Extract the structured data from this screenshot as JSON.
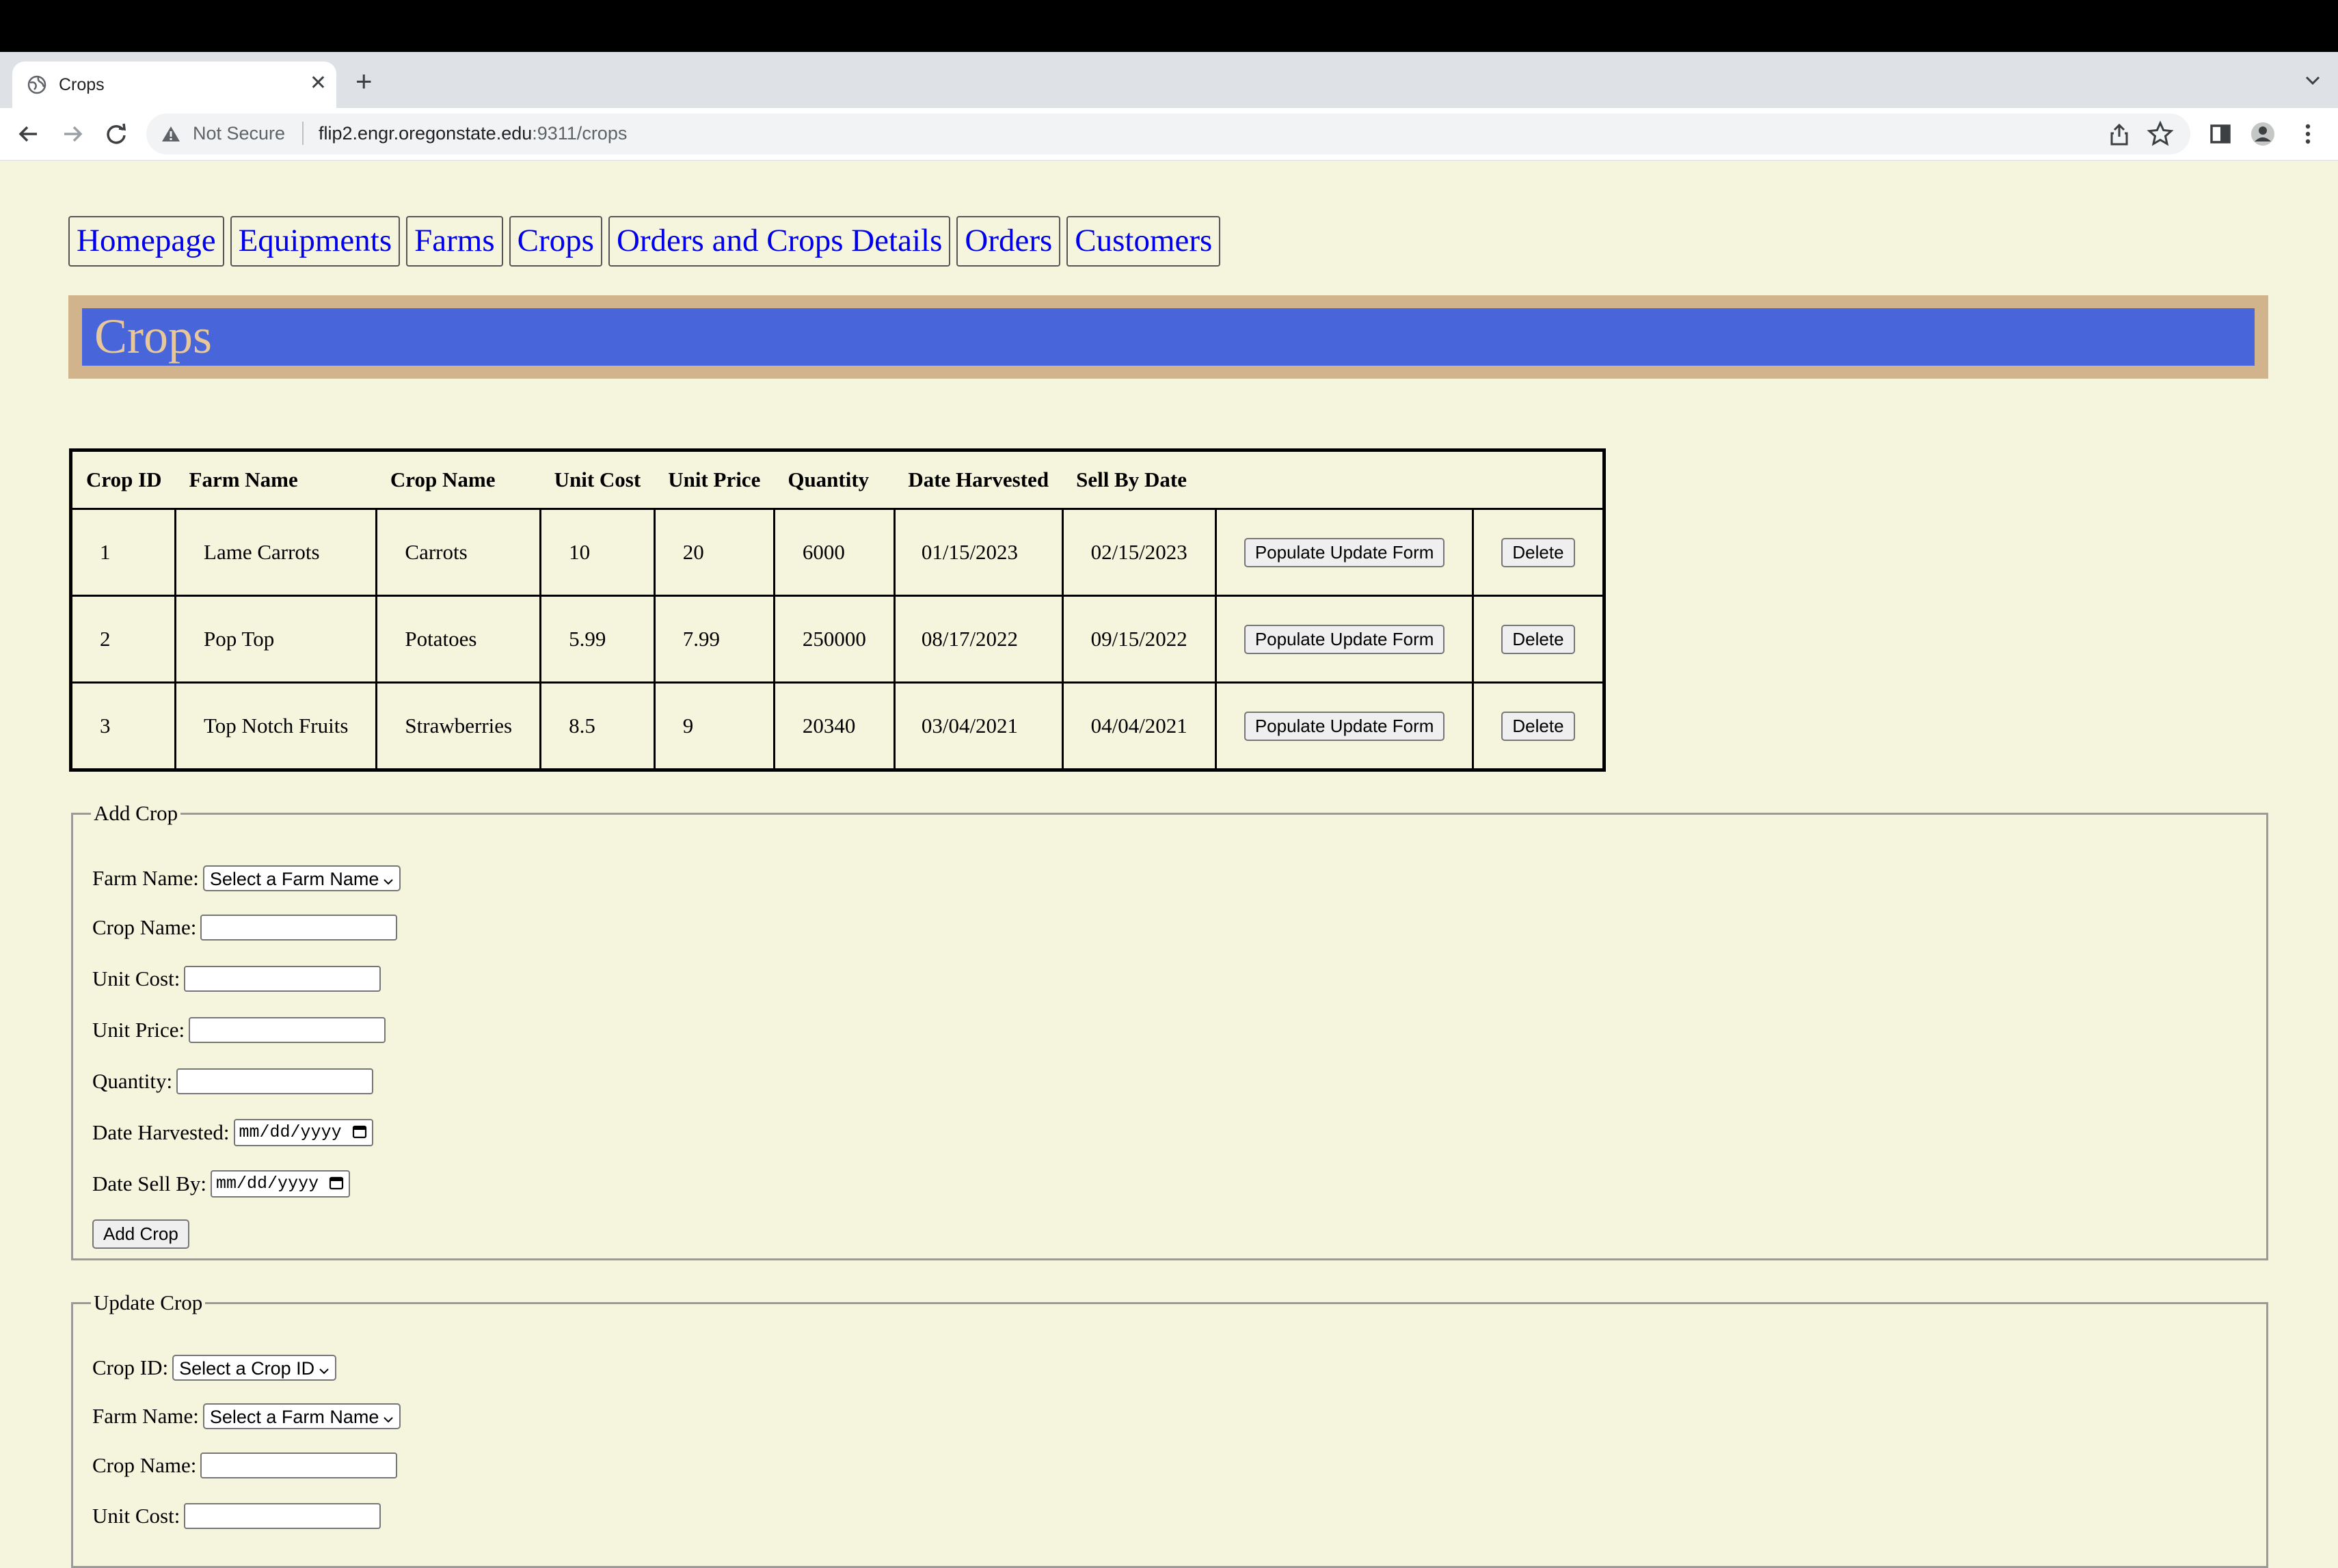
{
  "browser": {
    "tab_title": "Crops",
    "security_label": "Not Secure",
    "url_host": "flip2.engr.oregonstate.edu",
    "url_path": ":9311/crops"
  },
  "nav": [
    "Homepage",
    "Equipments",
    "Farms",
    "Crops",
    "Orders and Crops Details",
    "Orders",
    "Customers"
  ],
  "page_title": "Crops",
  "table": {
    "headers": [
      "Crop ID",
      "Farm Name",
      "Crop Name",
      "Unit Cost",
      "Unit Price",
      "Quantity",
      "Date Harvested",
      "Sell By Date"
    ],
    "rows": [
      [
        "1",
        "Lame Carrots",
        "Carrots",
        "10",
        "20",
        "6000",
        "01/15/2023",
        "02/15/2023"
      ],
      [
        "2",
        "Pop Top",
        "Potatoes",
        "5.99",
        "7.99",
        "250000",
        "08/17/2022",
        "09/15/2022"
      ],
      [
        "3",
        "Top Notch Fruits",
        "Strawberries",
        "8.5",
        "9",
        "20340",
        "03/04/2021",
        "04/04/2021"
      ]
    ],
    "populate_label": "Populate Update Form",
    "delete_label": "Delete"
  },
  "add_form": {
    "legend": "Add Crop",
    "farm_label": "Farm Name:",
    "farm_select": "Select a Farm Name",
    "crop_label": "Crop Name:",
    "cost_label": "Unit Cost:",
    "price_label": "Unit Price:",
    "qty_label": "Quantity:",
    "harvest_label": "Date Harvested:",
    "sellby_label": "Date Sell By:",
    "date_placeholder": "mm/dd/yyyy",
    "submit_label": "Add Crop"
  },
  "update_form": {
    "legend": "Update Crop",
    "id_label": "Crop ID:",
    "id_select": "Select a Crop ID",
    "farm_label": "Farm Name:",
    "farm_select": "Select a Farm Name",
    "crop_label": "Crop Name:",
    "cost_label": "Unit Cost:"
  },
  "colors": {
    "page_bg": "#f5f4dc",
    "banner_border": "#d2b48c",
    "banner_bg": "#4866d9",
    "banner_text": "#e8c79a",
    "link": "#0000ee"
  }
}
